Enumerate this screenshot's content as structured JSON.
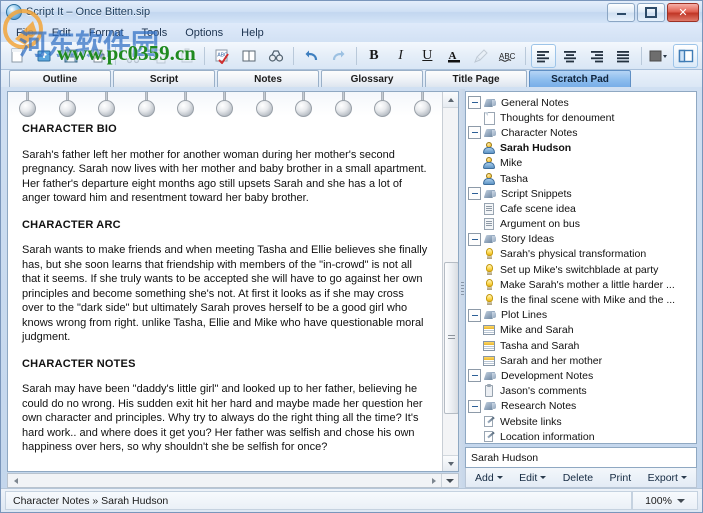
{
  "window": {
    "title": "Script It – Once Bitten.sip",
    "app_icon": "app-globe-icon",
    "buttons": {
      "minimize": "minimize-icon",
      "maximize": "maximize-icon",
      "close": "✕"
    }
  },
  "menubar": {
    "items": [
      "File",
      "Edit",
      "Format",
      "Tools",
      "Options",
      "Help"
    ]
  },
  "toolbar": {
    "groups": [
      [
        {
          "name": "new-document-icon",
          "glyph": "new",
          "state": "enabled"
        },
        {
          "name": "open-folder-icon",
          "glyph": "open",
          "state": "enabled"
        },
        {
          "name": "save-icon",
          "glyph": "save",
          "state": "enabled"
        },
        {
          "name": "print-icon",
          "glyph": "print",
          "state": "enabled"
        }
      ],
      [
        {
          "name": "cut-scissors-icon",
          "glyph": "cut",
          "state": "disabled"
        },
        {
          "name": "copy-icon",
          "glyph": "copy",
          "state": "disabled"
        },
        {
          "name": "paste-icon",
          "glyph": "paste",
          "state": "disabled"
        }
      ],
      [
        {
          "name": "spellcheck-icon",
          "glyph": "abc-check",
          "state": "enabled"
        },
        {
          "name": "dictionary-book-icon",
          "glyph": "book",
          "state": "enabled"
        },
        {
          "name": "find-binoculars-icon",
          "glyph": "binoculars",
          "state": "enabled"
        }
      ],
      [
        {
          "name": "undo-icon",
          "glyph": "undo",
          "state": "enabled"
        },
        {
          "name": "redo-icon",
          "glyph": "redo",
          "state": "enabled"
        }
      ],
      [
        {
          "name": "bold-button",
          "glyph": "B",
          "state": "enabled"
        },
        {
          "name": "italic-button",
          "glyph": "I",
          "state": "enabled"
        },
        {
          "name": "underline-button",
          "glyph": "U",
          "state": "enabled"
        },
        {
          "name": "font-color-button",
          "glyph": "A",
          "state": "enabled"
        },
        {
          "name": "highlight-button",
          "glyph": "highlighter",
          "state": "disabled"
        },
        {
          "name": "spelling-abc-button",
          "glyph": "ABC",
          "state": "enabled"
        }
      ],
      [
        {
          "name": "align-left-button",
          "glyph": "align-left",
          "state": "active"
        },
        {
          "name": "align-center-button",
          "glyph": "align-center",
          "state": "enabled"
        },
        {
          "name": "align-right-button",
          "glyph": "align-right",
          "state": "enabled"
        },
        {
          "name": "align-justify-button",
          "glyph": "align-justify",
          "state": "enabled"
        }
      ],
      [
        {
          "name": "color-swatch-button",
          "glyph": "swatch",
          "state": "enabled"
        },
        {
          "name": "toggle-side-panel-button",
          "glyph": "panel",
          "state": "active"
        }
      ]
    ]
  },
  "watermark": {
    "url": "www.pc0359.cn",
    "cn_text": "河东软件园"
  },
  "tabs": {
    "items": [
      "Outline",
      "Script",
      "Notes",
      "Glossary",
      "Title Page",
      "Scratch Pad"
    ],
    "selected_index": 5
  },
  "editor": {
    "ring_count": 11,
    "sections": [
      {
        "heading": "CHARACTER BIO",
        "body": "Sarah's father left her mother for another woman during her mother's second pregnancy.  Sarah now lives with her mother and baby brother in a small apartment. Her father's departure eight months ago still upsets Sarah and she has a lot of anger toward him and resentment toward her baby brother."
      },
      {
        "heading": "CHARACTER ARC",
        "body": "Sarah wants to make friends and when meeting Tasha and Ellie believes she finally has, but she soon learns that friendship with members of the \"in-crowd\" is not all that it seems.  If she truly wants to be accepted she will have to go against her own principles and become something she's not.  At first it looks as if she may cross over to the \"dark side\" but ultimately Sarah proves herself to be a good girl who knows wrong from right. unlike Tasha, Ellie and Mike who have questionable moral judgment."
      },
      {
        "heading": "CHARACTER NOTES",
        "body": "Sarah may have been \"daddy's little girl\" and looked up to her father, believing he could do no wrong.  His sudden exit hit her hard and maybe made her question her own character and principles.  Why try to always do the right thing all the time?  It's hard work.. and where does it get you? Her father was selfish and chose his own happiness over hers, so why shouldn't she be selfish for once?"
      }
    ]
  },
  "tree": {
    "nodes": [
      {
        "label": "General Notes",
        "icon": "tag-icon",
        "level": 0,
        "expander": "minus",
        "bold": false
      },
      {
        "label": "Thoughts for denoument",
        "icon": "page-icon",
        "level": 1,
        "expander": "none",
        "bold": false
      },
      {
        "label": "Character Notes",
        "icon": "tag-icon",
        "level": 0,
        "expander": "minus",
        "bold": false
      },
      {
        "label": "Sarah Hudson",
        "icon": "person-icon",
        "level": 1,
        "expander": "none",
        "bold": true
      },
      {
        "label": "Mike",
        "icon": "person-icon",
        "level": 1,
        "expander": "none",
        "bold": false
      },
      {
        "label": "Tasha",
        "icon": "person-icon",
        "level": 1,
        "expander": "none",
        "bold": false
      },
      {
        "label": "Script Snippets",
        "icon": "tag-icon",
        "level": 0,
        "expander": "minus",
        "bold": false
      },
      {
        "label": "Cafe scene idea",
        "icon": "doc-lines-icon",
        "level": 1,
        "expander": "none",
        "bold": false
      },
      {
        "label": "Argument on bus",
        "icon": "doc-lines-icon",
        "level": 1,
        "expander": "none",
        "bold": false
      },
      {
        "label": "Story Ideas",
        "icon": "tag-icon",
        "level": 0,
        "expander": "minus",
        "bold": false
      },
      {
        "label": "Sarah's physical transformation",
        "icon": "lightbulb-icon",
        "level": 1,
        "expander": "none",
        "bold": false
      },
      {
        "label": "Set up Mike's switchblade at party",
        "icon": "lightbulb-icon",
        "level": 1,
        "expander": "none",
        "bold": false
      },
      {
        "label": "Make Sarah's mother a little harder ...",
        "icon": "lightbulb-icon",
        "level": 1,
        "expander": "none",
        "bold": false
      },
      {
        "label": "Is the final scene with Mike and the ...",
        "icon": "lightbulb-icon",
        "level": 1,
        "expander": "none",
        "bold": false
      },
      {
        "label": "Plot Lines",
        "icon": "tag-icon",
        "level": 0,
        "expander": "minus",
        "bold": false
      },
      {
        "label": "Mike and Sarah",
        "icon": "plotline-card-icon",
        "level": 1,
        "expander": "none",
        "bold": false
      },
      {
        "label": "Tasha and Sarah",
        "icon": "plotline-card-icon",
        "level": 1,
        "expander": "none",
        "bold": false
      },
      {
        "label": "Sarah and her mother",
        "icon": "plotline-card-icon",
        "level": 1,
        "expander": "none",
        "bold": false
      },
      {
        "label": "Development Notes",
        "icon": "tag-icon",
        "level": 0,
        "expander": "minus",
        "bold": false
      },
      {
        "label": "Jason's comments",
        "icon": "clipboard-icon",
        "level": 1,
        "expander": "none",
        "bold": false
      },
      {
        "label": "Research Notes",
        "icon": "tag-icon",
        "level": 0,
        "expander": "minus",
        "bold": false
      },
      {
        "label": "Website links",
        "icon": "research-page-icon",
        "level": 1,
        "expander": "none",
        "bold": false
      },
      {
        "label": "Location information",
        "icon": "research-page-icon",
        "level": 1,
        "expander": "none",
        "bold": false
      }
    ]
  },
  "name_field": {
    "value": "Sarah Hudson"
  },
  "item_buttons": [
    {
      "label": "Add",
      "has_caret": true
    },
    {
      "label": "Edit",
      "has_caret": true
    },
    {
      "label": "Delete",
      "has_caret": false
    },
    {
      "label": "Print",
      "has_caret": false
    },
    {
      "label": "Export",
      "has_caret": true
    }
  ],
  "statusbar": {
    "path": "Character Notes » Sarah Hudson",
    "zoom": "100%"
  },
  "colors": {
    "accent": "#77aee8",
    "selected_tab": "#8dbdee",
    "frame": "#8fa8c2",
    "watermark_green": "#1f8a1f"
  }
}
